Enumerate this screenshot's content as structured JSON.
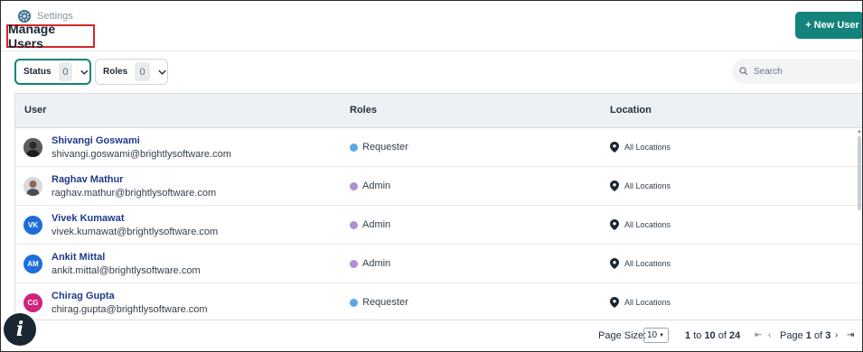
{
  "breadcrumb": {
    "label": "Settings"
  },
  "page": {
    "title": "Manage Users"
  },
  "actions": {
    "new_user": "+ New User"
  },
  "filters": {
    "status": {
      "label": "Status",
      "count": "0"
    },
    "roles": {
      "label": "Roles",
      "count": "0"
    }
  },
  "search": {
    "placeholder": "Search"
  },
  "table": {
    "headers": {
      "user": "User",
      "roles": "Roles",
      "location": "Location"
    },
    "rows": [
      {
        "name": "Shivangi Goswami",
        "email": "shivangi.goswami@brightlysoftware.com",
        "role": "Requester",
        "location": "All Locations"
      },
      {
        "name": "Raghav Mathur",
        "email": "raghav.mathur@brightlysoftware.com",
        "role": "Admin",
        "location": "All Locations"
      },
      {
        "name": "Vivek Kumawat",
        "email": "vivek.kumawat@brightlysoftware.com",
        "role": "Admin",
        "location": "All Locations",
        "initials": "VK"
      },
      {
        "name": "Ankit Mittal",
        "email": "ankit.mittal@brightlysoftware.com",
        "role": "Admin",
        "location": "All Locations",
        "initials": "AM"
      },
      {
        "name": "Chirag Gupta",
        "email": "chirag.gupta@brightlysoftware.com",
        "role": "Requester",
        "location": "All Locations",
        "initials": "CG"
      }
    ]
  },
  "colors": {
    "accent": "#13837c",
    "requester_dot": "#5aa9e6",
    "admin_dot": "#b18fd1",
    "avatar_vk": "#1d6ddb",
    "avatar_am": "#1d6ddb",
    "avatar_cg": "#d0237a"
  },
  "pagination": {
    "page_size_label": "Page Size:",
    "page_size_value": "10",
    "range_start": "1",
    "range_to": "to",
    "range_end": "10",
    "range_of": "of",
    "total": "24",
    "page_label": "Page",
    "current_page": "1",
    "page_of": "of",
    "total_pages": "3"
  },
  "info": {
    "glyph": "i"
  }
}
